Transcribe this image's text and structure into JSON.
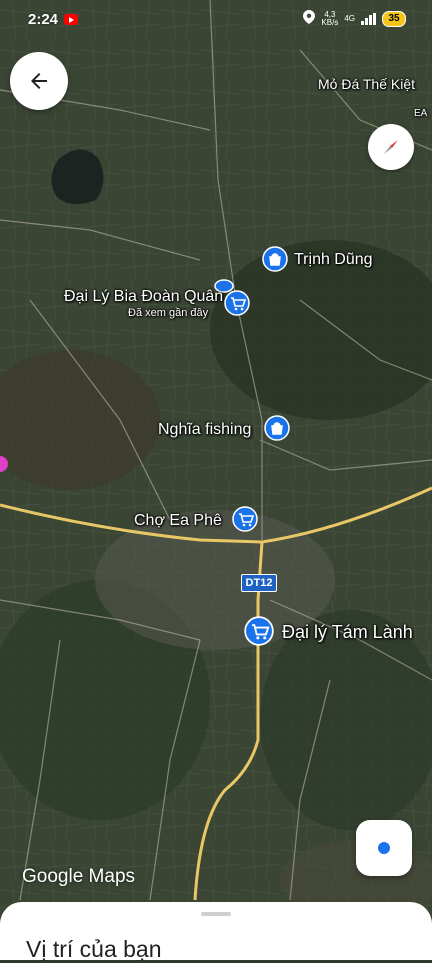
{
  "status_bar": {
    "time": "2:24",
    "net_speed": "4,3",
    "net_unit": "KB/s",
    "network": "4G",
    "battery": "35"
  },
  "map": {
    "road_shield": "DT12",
    "places": [
      {
        "name": "Mỏ Đá Thế Kiệt"
      },
      {
        "name": "Trịnh Dũng",
        "category": "shopping"
      },
      {
        "name": "Đại Lý Bia Đoàn Quân",
        "subtitle": "Đã xem gần đây",
        "category": "shopping"
      },
      {
        "name": "Nghĩa fishing",
        "category": "shopping"
      },
      {
        "name": "Chợ Ea Phê",
        "category": "market"
      },
      {
        "name": "Đại lý Tám Lành",
        "category": "market"
      }
    ],
    "edge_label": "EA",
    "pin_color": "#1a73e8",
    "road_color": "#e8c766"
  },
  "branding": {
    "google_maps": "Google Maps"
  },
  "sheet": {
    "title": "Vị trí của bạn"
  }
}
